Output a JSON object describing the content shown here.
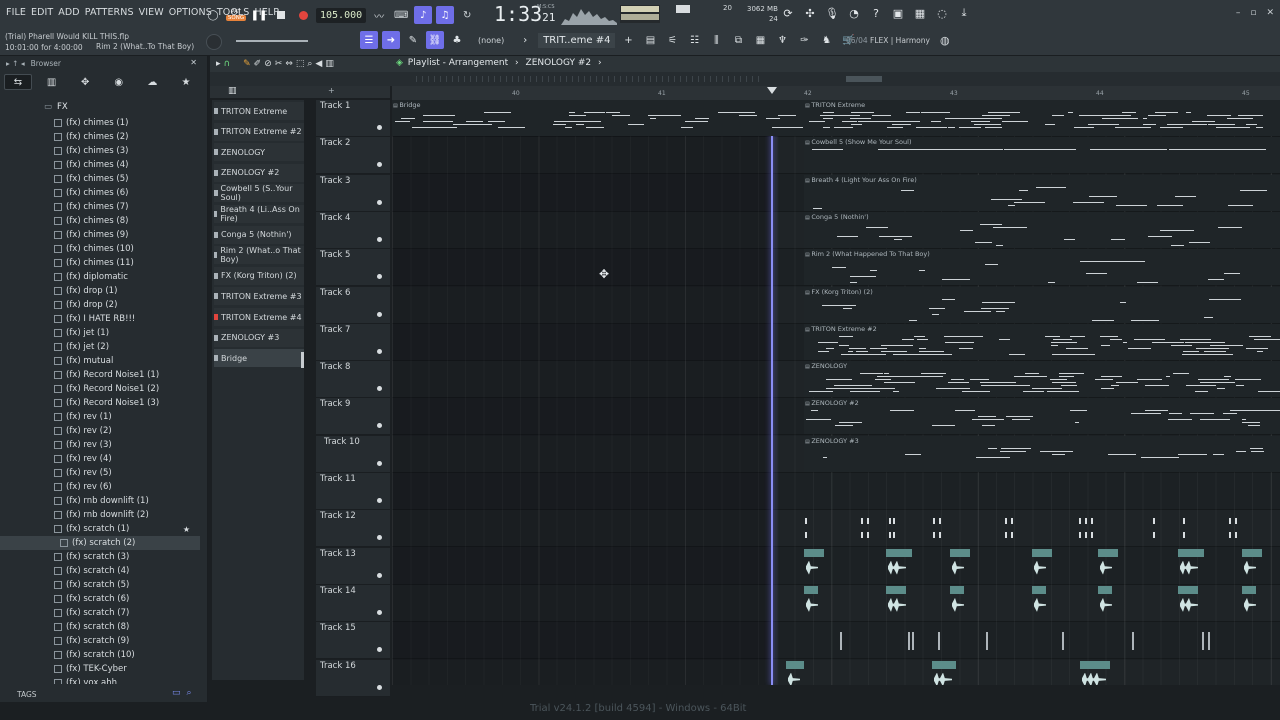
{
  "menu": [
    "FILE",
    "EDIT",
    "ADD",
    "PATTERNS",
    "VIEW",
    "OPTIONS",
    "TOOLS",
    "HELP"
  ],
  "song": {
    "file": "(Trial) Pharell Would KILL THIS.flp",
    "position": "10:01:00 for 4:00:00",
    "hint": "Rim 2 (What..To That Boy)"
  },
  "transport": {
    "pat_label": "PAT",
    "song_label": "SONG",
    "tempo": "105.000",
    "time_main": "1:33",
    "time_sub": "21",
    "msc_label": "M:S:CS",
    "polyphony": "20",
    "voices": "24",
    "memory": "3062 MB"
  },
  "toolbar": {
    "snap": "(none)",
    "pattern": "TRIT..eme #4",
    "harmony_count": "06/04",
    "harmony_label": "FLEX | Harmony"
  },
  "browser": {
    "title": "Browser",
    "folder": "FX",
    "items": [
      "(fx) chimes (1)",
      "(fx) chimes (2)",
      "(fx) chimes (3)",
      "(fx) chimes (4)",
      "(fx) chimes (5)",
      "(fx) chimes (6)",
      "(fx) chimes (7)",
      "(fx) chimes (8)",
      "(fx) chimes (9)",
      "(fx) chimes (10)",
      "(fx) chimes (11)",
      "(fx) diplomatic",
      "(fx) drop (1)",
      "(fx) drop (2)",
      "(fx) I HATE RB!!!",
      "(fx) jet (1)",
      "(fx) jet (2)",
      "(fx) mutual",
      "(fx) Record Noise1 (1)",
      "(fx) Record Noise1 (2)",
      "(fx) Record Noise1 (3)",
      "(fx) rev (1)",
      "(fx) rev (2)",
      "(fx) rev (3)",
      "(fx) rev (4)",
      "(fx) rev (5)",
      "(fx) rev (6)",
      "(fx) rnb downlift (1)",
      "(fx) rnb downlift (2)",
      "(fx) scratch (1)",
      "(fx) scratch (2)",
      "(fx) scratch (3)",
      "(fx) scratch (4)",
      "(fx) scratch (5)",
      "(fx) scratch (6)",
      "(fx) scratch (7)",
      "(fx) scratch (8)",
      "(fx) scratch (9)",
      "(fx) scratch (10)",
      "(fx) TEK-Cyber",
      "(fx) vox ahh"
    ],
    "selected_index": 30,
    "tags_label": "TAGS"
  },
  "playlist": {
    "title": "Playlist - Arrangement",
    "pattern": "ZENOLOGY #2",
    "patterns": [
      "TRITON Extreme",
      "TRITON Extreme #2",
      "ZENOLOGY",
      "ZENOLOGY #2",
      "Cowbell 5 (S..Your Soul)",
      "Breath 4 (Li..Ass On Fire)",
      "Conga 5 (Nothin')",
      "Rim 2 (What..o That Boy)",
      "FX (Korg Triton) (2)",
      "TRITON Extreme #3",
      "TRITON Extreme #4",
      "ZENOLOGY #3",
      "Bridge"
    ],
    "tracks": [
      "Track 1",
      "Track 2",
      "Track 3",
      "Track 4",
      "Track 5",
      "Track 6",
      "Track 7",
      "Track 8",
      "Track 9",
      "Track 10",
      "Track 11",
      "Track 12",
      "Track 13",
      "Track 14",
      "Track 15",
      "Track 16"
    ],
    "bar_numbers": [
      "40",
      "41",
      "42",
      "43",
      "44",
      "45"
    ],
    "clips": {
      "bridge": "Bridge",
      "t1": "TRITON Extreme",
      "t2": "Cowbell 5 (Show Me Your Soul)",
      "t3": "Breath 4 (Light Your Ass On Fire)",
      "t4": "Conga 5 (Nothin')",
      "t5": "Rim 2 (What Happened To That Boy)",
      "t6": "FX (Korg Triton) (2)",
      "t7": "TRITON Extreme #2",
      "t8": "ZENOLOGY",
      "t9": "ZENOLOGY #2",
      "t10": "ZENOLOGY #3"
    }
  },
  "status": "Trial v24.1.2 [build 4594] - Windows - 64Bit",
  "colors": {
    "accent": "#6f6ee8",
    "record": "#e2453e",
    "audio_clip": "#5c8d8a"
  }
}
